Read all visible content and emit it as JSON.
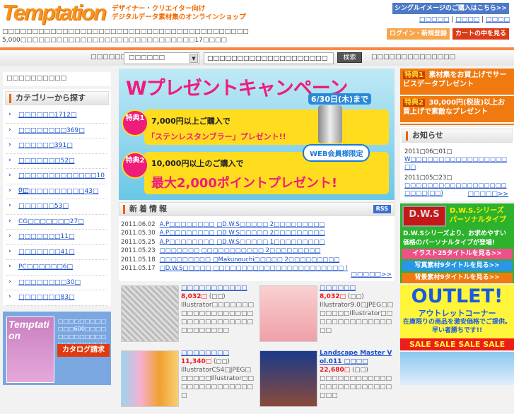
{
  "header": {
    "logo": "Temptation",
    "tagline_1": "デザイナー・クリエイター向け",
    "tagline_2": "デジタルデータ素材集のオンラインショップ",
    "desc_1": "□□□□□□□□□□□□□□□□□□□□□□□□□□□□□□□□□□□□□□□□□",
    "desc_2": "5,000□□□□□□□□□□□□□□□□□□□□□□□□□□□□□17□□□□",
    "single_image_button": "シングルイメージのご購入はこちら>>",
    "top_links": [
      "□□□□□",
      "□□□□",
      "□□□□"
    ],
    "login_button": "ログイン・新規登録",
    "cart_button": "カートの中を見る"
  },
  "search": {
    "label": "□□□□□□□□",
    "select_value": "□□□□□□",
    "input_value": "□□□□□□□□□□□□□□□□□□□□",
    "button": "検索",
    "side_text": "□□□□□□□□□□□□□□"
  },
  "sidebar": {
    "top_box": "□□□□□□□□□□",
    "category_title": "カテゴリーから探す",
    "categories": [
      "□□□□□□1712□",
      "□□□□□□□□369□",
      "□□□□□□391□",
      "□□□□□□□52□",
      "□□□□□□□□□□□□□100□",
      "□□□□□□□□□□□43□",
      "□□□□□□53□",
      "CG□□□□□□□27□",
      "□□□□□□□11□",
      "□□□□□□□41□",
      "PC□□□□□□6□",
      "□□□□□□□□30□",
      "□□□□□□□83□"
    ],
    "catalog": {
      "cover_title": "Temptation",
      "text": "□□□□□□□□□□□□600□□□□□□□□□□□□□□□□□□□□□□□□□□",
      "button": "カタログ請求"
    }
  },
  "banner": {
    "title": "Wプレゼントキャンペーン",
    "date": "6/30日(木)まで",
    "perk1_badge": "特典1",
    "perk1_line1": "7,000円以上ご購入で",
    "perk1_line2": "「ステンレスタンブラー」プレゼント!!",
    "perk2_badge": "特典2",
    "perk2_line1": "10,000円以上のご購入で",
    "perk2_line2": "最大2,000ポイントプレゼント!",
    "bubble": "WEB会員様限定"
  },
  "news": {
    "title": "新着情報",
    "rss": "RSS",
    "items": [
      {
        "date": "2011.06.02",
        "text": "A.P□□□□□□□□ □D.W.S□□□□□ 2□□□□□□□□□"
      },
      {
        "date": "2011.05.30",
        "text": "A.P□□□□□□□□ □D.W.S□□□□□ 2□□□□□□□□□"
      },
      {
        "date": "2011.05.25",
        "text": "A.P□□□□□□□□ □D.W.S□□□□□ 1□□□□□□□□□"
      },
      {
        "date": "2011.05.23",
        "text": "□□□□□□□ □□□□□□□□□□□ 2□□□□□□□□□"
      },
      {
        "date": "2011.05.18",
        "text": "□□□□□□□□□ □Makunouchi□□□□□ 2□□□□□□□□□"
      },
      {
        "date": "2011.05.17",
        "text": "□D.W.S□□□□□ □□□□□□□□□□□□□□□□□□□□□□□ !"
      }
    ],
    "more": "□□□□□>>"
  },
  "products": [
    {
      "title": "□□□□□□□□□□□",
      "price": "8,032□",
      "tax": "(□□)",
      "desc": "Illustrator□□□□□□□□□□□□□□□□□□□□□□□□□□□□□□□□□□□□□□□"
    },
    {
      "title": "□□□□□□",
      "price": "8,032□",
      "tax": "(□□)",
      "desc": "Illustrator9.0□JPEG□□□□□□□Illustrator□□□□□□□□□□□□□□□□"
    },
    {
      "title": "□□□□□□□□",
      "price": "11,340□",
      "tax": "(□□)",
      "desc": "IllustratorCS4□JPEG□□□□□□Illustrator□□□□□□□□□□□□□□□"
    },
    {
      "title": "Landscape Master Vol.011 □□□□",
      "price": "22,680□",
      "tax": "(□□)",
      "desc": "□□□□□□□□□□□□□□□□□□□□□□□□□□□"
    }
  ],
  "right": {
    "perk1_tag": "特典1",
    "perk1_text": "素材集をお買上げでサービスデータプレゼント",
    "perk2_tag": "特典2",
    "perk2_text": "30,000円(税抜)以上お買上げで素敵なプレゼント",
    "info_title": "お知らせ",
    "info": [
      {
        "date": "2011□06□01□",
        "text": "W□□□□□□□□□□□□□□□□□□□"
      },
      {
        "date": "2011□05□23□",
        "text": "□□□□□□□□□□□□□□□□□□□□□□(□□)"
      }
    ],
    "info_more": "□□□□□>>",
    "dws": {
      "logo": "D.W.S",
      "title": "D.W.S.シリーズ パーソナルタイプ",
      "desc": "D.W.Sシリーズより、お求めやすい価格のパーソナルタイプが登場!",
      "btn_illust": "イラスト25タイトルを見る>>",
      "btn_photo": "写真素材9タイトルを見る>>",
      "btn_bg": "背景素材9タイトルを見る>>"
    },
    "outlet": {
      "title": "OUTLET!",
      "subtitle": "アウトレットコーナー",
      "desc": "在庫限りの商品を激安価格でご提供。早い者勝ちです!!",
      "sale": "SALE SALE SALE SALE"
    }
  },
  "colors": {
    "accent": "#f7884a",
    "link": "#1a4fc9",
    "price": "#f01818"
  }
}
